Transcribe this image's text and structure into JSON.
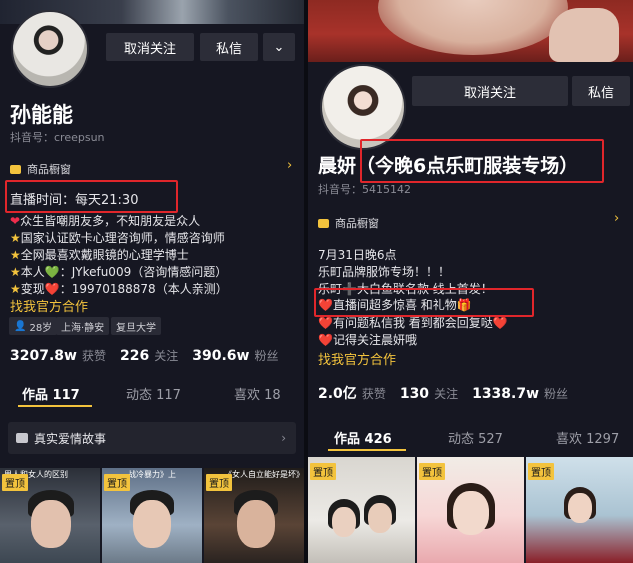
{
  "left": {
    "follow_btn": "取消关注",
    "message_btn": "私信",
    "more_btn": "⌄",
    "name": "孙能能",
    "account_id": "抖音号：creepsun",
    "shop_label": "商品橱窗",
    "live_time": "直播时间：每天21:30",
    "bio": [
      "众生皆嘲朋友多，不知朋友是众人",
      "国家认证欧卡心理咨询师，情感咨询师",
      "全网最喜欢戴眼镜的心理学博士",
      "本人💚：JYkefu009（咨询情感问题）",
      "变现❤️：19970188878（本人亲测）"
    ],
    "cooperation_link": "找我官方合作",
    "tags": [
      "28岁",
      "上海·静安",
      "复旦大学"
    ],
    "stats": [
      {
        "value": "3207.8w",
        "label": "获赞"
      },
      {
        "value": "226",
        "label": "关注"
      },
      {
        "value": "390.6w",
        "label": "粉丝"
      }
    ],
    "tabs": [
      "作品 117",
      "动态 117",
      "喜欢 18"
    ],
    "collection": "真实爱情故事",
    "thumbs": [
      {
        "pin": "置顶",
        "caption": "男人和女人的区别"
      },
      {
        "pin": "置顶",
        "caption": "战冷暴力》上"
      },
      {
        "pin": "置顶",
        "caption": "《女人自立能好是坏》"
      }
    ]
  },
  "right": {
    "follow_btn": "取消关注",
    "message_btn": "私信",
    "name": "晨妍（今晚6点乐町服装专场）",
    "account_id": "抖音号：5415142",
    "shop_label": "商品橱窗",
    "bio": [
      "7月31日晚6点",
      "乐町品牌服饰专场！！！",
      "乐町➕大白鱼联名款 线上首发！",
      "❤️直播间超多惊喜 和礼物🎁",
      "❤️有问题私信我 看到都会回复哒❤️",
      "❤️记得关注晨妍哦"
    ],
    "cooperation_link": "找我官方合作",
    "stats": [
      {
        "value": "2.0亿",
        "label": "获赞"
      },
      {
        "value": "130",
        "label": "关注"
      },
      {
        "value": "1338.7w",
        "label": "粉丝"
      }
    ],
    "tabs": [
      "作品 426",
      "动态 527",
      "喜欢 1297"
    ],
    "thumbs": [
      {
        "pin": "置顶"
      },
      {
        "pin": "置顶"
      },
      {
        "pin": "置顶"
      }
    ]
  },
  "colors": {
    "accent": "#f3c33d",
    "highlight_box": "#e0262b",
    "background": "#161722"
  }
}
